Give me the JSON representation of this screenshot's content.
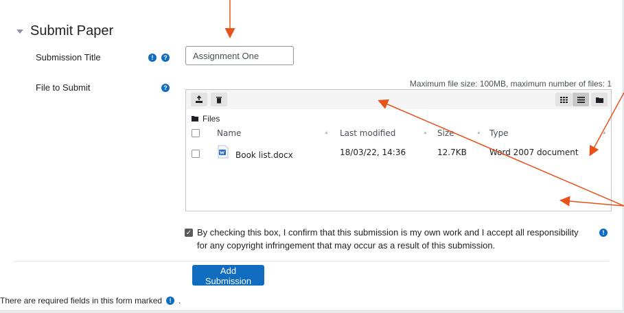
{
  "section": {
    "title": "Submit Paper"
  },
  "form": {
    "submission_title_label": "Submission Title",
    "submission_title_value": "Assignment One",
    "file_label": "File to Submit"
  },
  "filepicker": {
    "limits": "Maximum file size: 100MB, maximum number of files: 1",
    "path": "Files",
    "columns": [
      "Name",
      "Last modified",
      "Size",
      "Type"
    ],
    "file": {
      "name": "Book list.docx",
      "modified": "18/03/22, 14:36",
      "size": "12.7KB",
      "type": "Word 2007 document"
    }
  },
  "confirm": {
    "text": "By checking this box, I confirm that this submission is my own work and I accept all responsibility for any copyright infringement that may occur as a result of this submission."
  },
  "actions": {
    "submit_label": "Add Submission"
  },
  "footer": {
    "required_note": "There are required fields in this form marked",
    "period": "."
  },
  "colors": {
    "accent": "#0f6cbf",
    "annotation": "#e8521a"
  },
  "icons": [
    "chevron-down-icon",
    "required-icon",
    "help-icon",
    "upload-icon",
    "delete-icon",
    "grid-view-icon",
    "list-view-icon",
    "folder-view-icon",
    "folder-icon",
    "docx-file-icon"
  ]
}
